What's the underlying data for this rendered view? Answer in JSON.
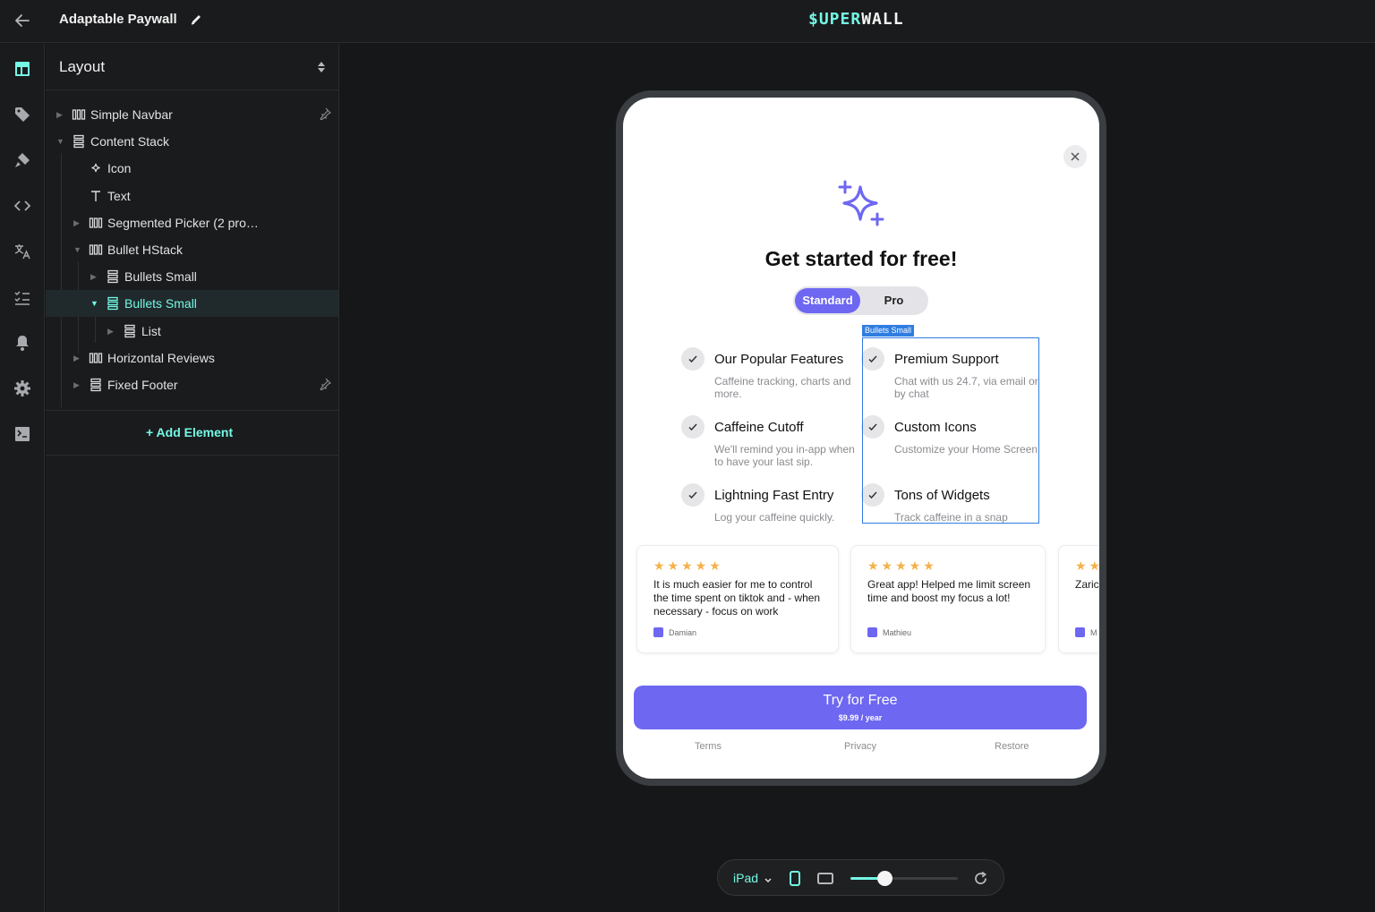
{
  "app": {
    "title": "Adaptable Paywall",
    "logo_prefix": "$UPER",
    "logo_suffix": "WALL",
    "accent": "#74f8e4"
  },
  "rail": {
    "icons": [
      "layout-icon",
      "tag-icon",
      "paint-icon",
      "code-icon",
      "translate-icon",
      "checklist-icon",
      "bell-icon",
      "gear-icon",
      "terminal-icon"
    ]
  },
  "panel": {
    "header": "Layout",
    "tree": [
      {
        "label": "Simple Navbar",
        "depth": 0,
        "icon": "hstack-icon",
        "expanded": false,
        "pinned": true
      },
      {
        "label": "Content Stack",
        "depth": 0,
        "icon": "vstack-icon",
        "expanded": true,
        "pinned": false
      },
      {
        "label": "Icon",
        "depth": 1,
        "icon": "sparkle-icon",
        "expanded": null,
        "pinned": false
      },
      {
        "label": "Text",
        "depth": 1,
        "icon": "text-icon",
        "expanded": null,
        "pinned": false
      },
      {
        "label": "Segmented Picker (2 pro…",
        "depth": 1,
        "icon": "hstack-icon",
        "expanded": false,
        "pinned": false
      },
      {
        "label": "Bullet HStack",
        "depth": 1,
        "icon": "hstack-icon",
        "expanded": true,
        "pinned": false
      },
      {
        "label": "Bullets Small",
        "depth": 2,
        "icon": "vstack-icon",
        "expanded": false,
        "pinned": false
      },
      {
        "label": "Bullets Small",
        "depth": 2,
        "icon": "vstack-icon",
        "expanded": true,
        "pinned": false,
        "selected": true
      },
      {
        "label": "List",
        "depth": 3,
        "icon": "vstack-icon",
        "expanded": false,
        "pinned": false
      },
      {
        "label": "Horizontal Reviews",
        "depth": 1,
        "icon": "hstack-icon",
        "expanded": false,
        "pinned": false
      },
      {
        "label": "Fixed Footer",
        "depth": 1,
        "icon": "vstack-icon",
        "expanded": false,
        "pinned": true
      }
    ],
    "add_element": "Add Element"
  },
  "paywall": {
    "headline": "Get started for free!",
    "segments": [
      "Standard",
      "Pro"
    ],
    "selected_segment": "Standard",
    "selection_tag": "Bullets Small",
    "features_left": [
      {
        "title": "Our Popular Features",
        "desc": "Caffeine tracking, charts and more."
      },
      {
        "title": "Caffeine Cutoff",
        "desc": "We'll remind you in-app when to have your last sip."
      },
      {
        "title": "Lightning Fast Entry",
        "desc": "Log your caffeine quickly."
      }
    ],
    "features_right": [
      {
        "title": "Premium Support",
        "desc": "Chat with us 24.7, via email or by chat"
      },
      {
        "title": "Custom Icons",
        "desc": "Customize your Home Screen"
      },
      {
        "title": "Tons of Widgets",
        "desc": "Track caffeine in a snap"
      }
    ],
    "reviews": [
      {
        "stars": "★★★★★",
        "text": "It is much easier for me to control the time spent on tiktok and - when necessary - focus on work",
        "author": "Damian"
      },
      {
        "stars": "★★★★★",
        "text": "Great app! Helped me limit screen time and boost my focus a lot!",
        "author": "Mathieu"
      },
      {
        "stars": "★★",
        "text": "Zaric intru and s",
        "author": "M"
      }
    ],
    "cta": {
      "label": "Try for Free",
      "price": "$9.99 / year"
    },
    "footer_links": [
      "Terms",
      "Privacy",
      "Restore"
    ],
    "brand_color": "#6d67f2"
  },
  "toolbar": {
    "device": "iPad",
    "zoom_fraction": 0.32
  }
}
